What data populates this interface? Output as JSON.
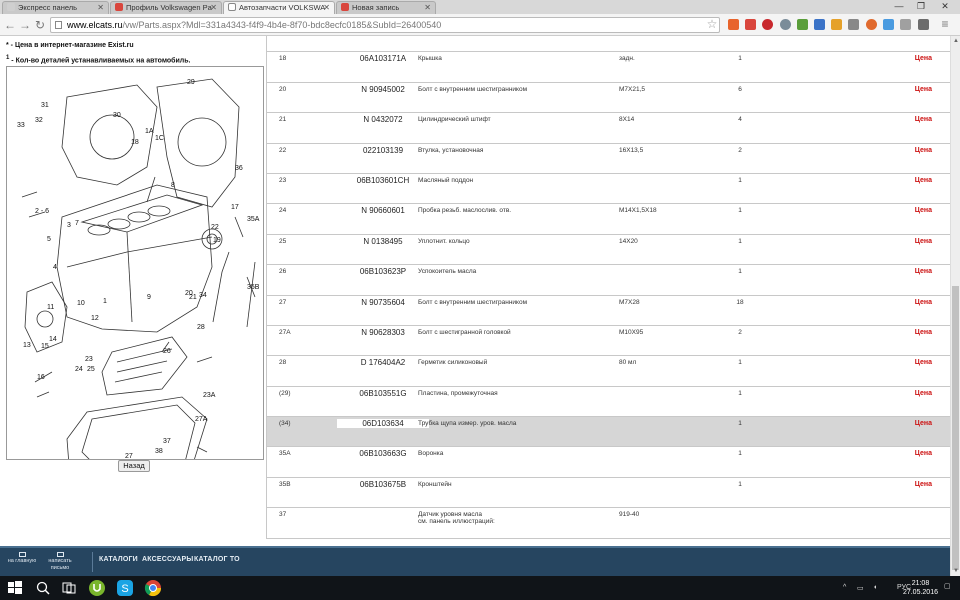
{
  "browser": {
    "tabs": [
      {
        "title": "Экспресс панель",
        "color": "#cfcfcf"
      },
      {
        "title": "Профиль Volkswagen Pa",
        "color": "#d9463d"
      },
      {
        "title": "Автозапчасти VOLKSWA",
        "color": "#ffffff",
        "active": true
      },
      {
        "title": "Новая запись",
        "color": "#d9463d"
      }
    ],
    "url_host": "www.elcats.ru",
    "url_path": "/vw/Parts.aspx?Mdl=331a4343-f4f9-4b4e-8f70-bdc8ecfc0185&SubId=26400540",
    "window_controls": {
      "minimize": "—",
      "maximize": "❐",
      "close": "✕"
    },
    "nav": {
      "back": "←",
      "forward": "→",
      "reload": "↻"
    }
  },
  "legend": {
    "line1": "* - Цена в интернет-магазине Exist.ru",
    "line2_mark": "1",
    "line2": " - Кол-во деталей устанавливаемых на автомобиль."
  },
  "diagram": {
    "callouts": [
      "1",
      "1A",
      "1C",
      "2 - 6",
      "3",
      "4",
      "5",
      "7",
      "8",
      "9",
      "10",
      "11",
      "12",
      "13",
      "14",
      "15",
      "16",
      "17",
      "18",
      "19",
      "20",
      "21",
      "22",
      "23",
      "23A",
      "24",
      "25",
      "26",
      "27",
      "27A",
      "28",
      "29",
      "30",
      "31",
      "32",
      "33",
      "34",
      "35A",
      "35B",
      "36",
      "37",
      "38"
    ],
    "back_label": "Назад"
  },
  "parts": [
    {
      "pos": "",
      "number": "",
      "name": "",
      "note": "",
      "qty": "",
      "price": ""
    },
    {
      "pos": "18",
      "number": "06A103171A",
      "name": "Крышка",
      "note": "задн.",
      "qty": "1",
      "price": "Цена"
    },
    {
      "pos": "20",
      "number": "N 90945002",
      "name": "Болт с внутренним шестигранником",
      "note": "M7X21,5",
      "qty": "6",
      "price": "Цена"
    },
    {
      "pos": "21",
      "number": "N 0432072",
      "name": "Цилиндрический штифт",
      "note": "8X14",
      "qty": "4",
      "price": "Цена"
    },
    {
      "pos": "22",
      "number": "022103139",
      "name": "Втулка, установочная",
      "note": "16X13,5",
      "qty": "2",
      "price": "Цена"
    },
    {
      "pos": "23",
      "number": "06B103601CH",
      "name": "Масляный поддон",
      "note": "",
      "qty": "1",
      "price": "Цена"
    },
    {
      "pos": "24",
      "number": "N 90660601",
      "name": "Пробка резьб. маслослив. отв.",
      "note": "M14X1,5X18",
      "qty": "1",
      "price": "Цена"
    },
    {
      "pos": "25",
      "number": "N 0138495",
      "name": "Уплотнит. кольцо",
      "note": "14X20",
      "qty": "1",
      "price": "Цена"
    },
    {
      "pos": "26",
      "number": "06B103623P",
      "name": "Успокоитель масла",
      "note": "",
      "qty": "1",
      "price": "Цена"
    },
    {
      "pos": "27",
      "number": "N 90735604",
      "name": "Болт с внутренним шестигранником",
      "note": "M7X28",
      "qty": "18",
      "price": "Цена"
    },
    {
      "pos": "27A",
      "number": "N 90628303",
      "name": "Болт с шестигранной головкой",
      "note": "M10X95",
      "qty": "2",
      "price": "Цена"
    },
    {
      "pos": "28",
      "number": "D 176404A2",
      "name": "Герметик силиконовый",
      "note": "80 мл",
      "qty": "1",
      "price": "Цена"
    },
    {
      "pos": "(29)",
      "number": "06B103551G",
      "name": "Пластина, промежуточная",
      "note": "",
      "qty": "1",
      "price": "Цена"
    },
    {
      "pos": "(34)",
      "number": "06D103634",
      "name": "Трубка щупа измер. уров. масла",
      "note": "",
      "qty": "1",
      "price": "Цена",
      "highlight": true
    },
    {
      "pos": "35A",
      "number": "06B103663G",
      "name": "Воронка",
      "note": "",
      "qty": "1",
      "price": "Цена"
    },
    {
      "pos": "35B",
      "number": "06B103675B",
      "name": "Кронштейн",
      "note": "",
      "qty": "1",
      "price": "Цена"
    },
    {
      "pos": "37",
      "number": "",
      "name": "Датчик уровня масла",
      "name2": "см. панель иллюстраций:",
      "note": "919-40",
      "qty": "",
      "price": ""
    }
  ],
  "footer": {
    "home": "на главную",
    "write": "написать письмо",
    "links": [
      "КАТАЛОГИ",
      "АКСЕССУАРЫ",
      "КАТАЛОГ ТО"
    ]
  },
  "taskbar": {
    "time": "21:08",
    "date": "27.05.2016",
    "lang": "РУС"
  },
  "colors": {
    "price": "#cc1111",
    "footer_bg": "#264560",
    "taskbar_bg": "#101418",
    "highlight_row": "#d6d6d6"
  }
}
